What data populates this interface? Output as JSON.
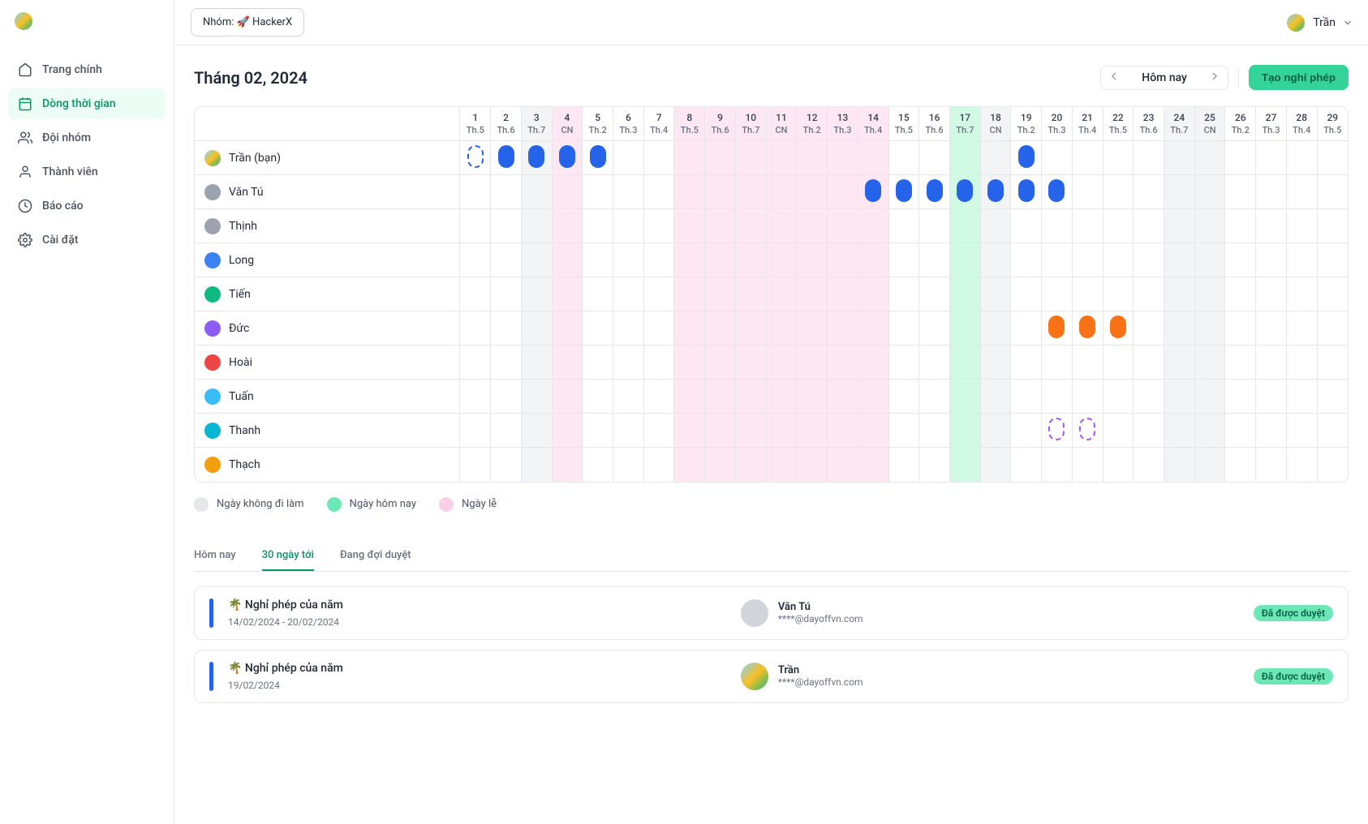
{
  "header": {
    "group_prefix": "Nhóm:",
    "group_name": "🚀 HackerX",
    "user_name": "Trần"
  },
  "sidebar": {
    "items": [
      {
        "label": "Trang chính",
        "icon": "home"
      },
      {
        "label": "Dòng thời gian",
        "icon": "calendar",
        "active": true
      },
      {
        "label": "Đội nhóm",
        "icon": "users"
      },
      {
        "label": "Thành viên",
        "icon": "user"
      },
      {
        "label": "Báo cáo",
        "icon": "clock"
      },
      {
        "label": "Cài đặt",
        "icon": "gear"
      }
    ]
  },
  "timeline": {
    "title": "Tháng 02, 2024",
    "today_label": "Hôm nay",
    "create_label": "Tạo nghỉ phép",
    "days": [
      {
        "n": "1",
        "wd": "Th.5"
      },
      {
        "n": "2",
        "wd": "Th.6"
      },
      {
        "n": "3",
        "wd": "Th.7",
        "noday": true
      },
      {
        "n": "4",
        "wd": "CN",
        "holiday": true
      },
      {
        "n": "5",
        "wd": "Th.2"
      },
      {
        "n": "6",
        "wd": "Th.3"
      },
      {
        "n": "7",
        "wd": "Th.4"
      },
      {
        "n": "8",
        "wd": "Th.5",
        "holiday": true
      },
      {
        "n": "9",
        "wd": "Th.6",
        "holiday": true
      },
      {
        "n": "10",
        "wd": "Th.7",
        "holiday": true
      },
      {
        "n": "11",
        "wd": "CN",
        "holiday": true
      },
      {
        "n": "12",
        "wd": "Th.2",
        "holiday": true
      },
      {
        "n": "13",
        "wd": "Th.3",
        "holiday": true
      },
      {
        "n": "14",
        "wd": "Th.4",
        "holiday": true
      },
      {
        "n": "15",
        "wd": "Th.5"
      },
      {
        "n": "16",
        "wd": "Th.6"
      },
      {
        "n": "17",
        "wd": "Th.7",
        "today": true
      },
      {
        "n": "18",
        "wd": "CN",
        "noday": true
      },
      {
        "n": "19",
        "wd": "Th.2"
      },
      {
        "n": "20",
        "wd": "Th.3"
      },
      {
        "n": "21",
        "wd": "Th.4"
      },
      {
        "n": "22",
        "wd": "Th.5"
      },
      {
        "n": "23",
        "wd": "Th.6"
      },
      {
        "n": "24",
        "wd": "Th.7",
        "noday": true
      },
      {
        "n": "25",
        "wd": "CN",
        "noday": true
      },
      {
        "n": "26",
        "wd": "Th.2"
      },
      {
        "n": "27",
        "wd": "Th.3"
      },
      {
        "n": "28",
        "wd": "Th.4"
      },
      {
        "n": "29",
        "wd": "Th.5"
      }
    ],
    "people": [
      {
        "name": "Trần (bạn)",
        "avatar_bg": "gradient",
        "marks": {
          "1": "dashed-blue",
          "2": "blue",
          "3": "blue",
          "4": "blue",
          "5": "blue",
          "19": "blue"
        }
      },
      {
        "name": "Văn Tú",
        "avatar_bg": "#9ca3af",
        "marks": {
          "14": "blue",
          "15": "blue",
          "16": "blue",
          "17": "blue",
          "18": "blue",
          "19": "blue",
          "20": "blue"
        }
      },
      {
        "name": "Thịnh",
        "avatar_bg": "#9ca3af",
        "marks": {}
      },
      {
        "name": "Long",
        "avatar_bg": "#3b82f6",
        "marks": {}
      },
      {
        "name": "Tiến",
        "avatar_bg": "#10b981",
        "marks": {}
      },
      {
        "name": "Đức",
        "avatar_bg": "#8b5cf6",
        "marks": {
          "20": "orange",
          "21": "orange",
          "22": "orange"
        }
      },
      {
        "name": "Hoài",
        "avatar_bg": "#ef4444",
        "marks": {}
      },
      {
        "name": "Tuấn",
        "avatar_bg": "#38bdf8",
        "marks": {}
      },
      {
        "name": "Thanh",
        "avatar_bg": "#06b6d4",
        "marks": {
          "20": "dashed-purple",
          "21": "dashed-purple"
        }
      },
      {
        "name": "Thạch",
        "avatar_bg": "#f59e0b",
        "marks": {}
      }
    ],
    "legend": [
      {
        "label": "Ngày không đi làm",
        "color": "#e5e7eb"
      },
      {
        "label": "Ngày hôm nay",
        "color": "#6ee7b7"
      },
      {
        "label": "Ngày lễ",
        "color": "#fbcfe8"
      }
    ]
  },
  "tabs": [
    {
      "label": "Hôm nay"
    },
    {
      "label": "30 ngày tới",
      "active": true
    },
    {
      "label": "Đang đợi duyệt"
    }
  ],
  "requests": [
    {
      "title": "🌴 Nghỉ phép của năm",
      "date": "14/02/2024 - 20/02/2024",
      "user_name": "Văn Tú",
      "user_email": "****@dayoffvn.com",
      "status": "Đã được duyệt",
      "avatar_bg": "#d1d5db"
    },
    {
      "title": "🌴 Nghỉ phép của năm",
      "date": "19/02/2024",
      "user_name": "Trần",
      "user_email": "****@dayoffvn.com",
      "status": "Đã được duyệt",
      "avatar_bg": "gradient"
    }
  ]
}
